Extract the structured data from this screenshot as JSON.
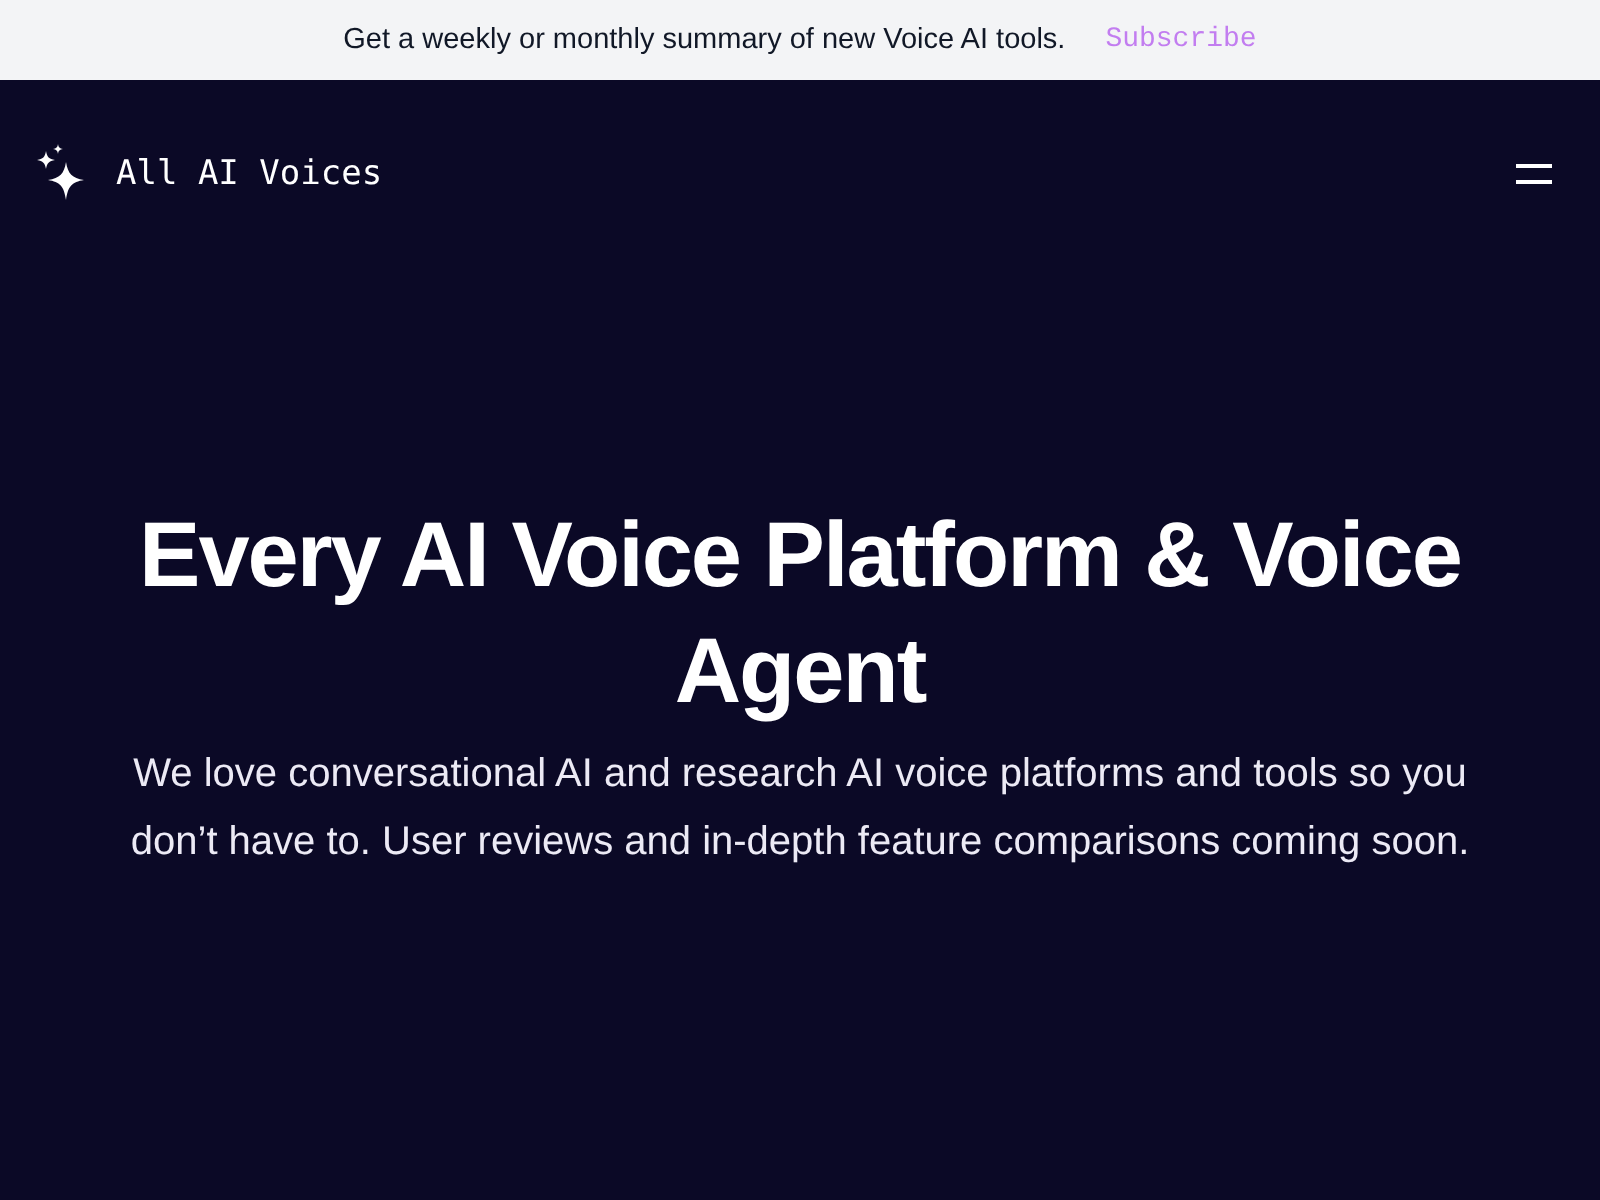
{
  "banner": {
    "text": "Get a weekly or monthly summary of new Voice AI tools.",
    "link": "Subscribe"
  },
  "header": {
    "logo_text": "All AI Voices"
  },
  "hero": {
    "title": "Every AI Voice Platform & Voice Agent",
    "subtitle": "We love conversational AI and research AI voice platforms and tools so you don’t have to. User reviews and in-depth feature comparisons coming soon."
  }
}
